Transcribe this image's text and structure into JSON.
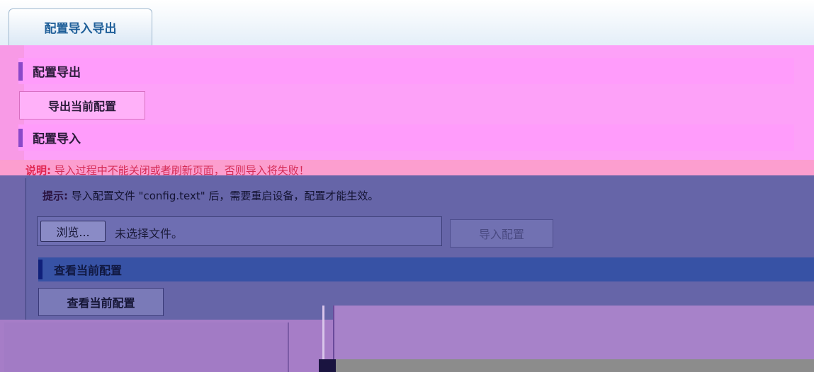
{
  "tab": {
    "label": "配置导入导出"
  },
  "export_section": {
    "title": "配置导出",
    "button_label": "导出当前配置"
  },
  "import_section": {
    "title": "配置导入",
    "note_prefix": "说明:",
    "note_text": "导入过程中不能关闭或者刷新页面，否则导入将失败！",
    "tip_prefix": "提示:",
    "tip_text": "导入配置文件 \"config.text\" 后，需要重启设备，配置才能生效。",
    "browse_label": "浏览...",
    "file_status": "未选择文件。",
    "import_button_label": "导入配置"
  },
  "view_section": {
    "title": "查看当前配置",
    "button_label": "查看当前配置"
  },
  "colors": {
    "pink_overlay": "#fda1f8",
    "purple_overlay": "#6665a8",
    "blue_bar": "#3752a5",
    "note_red": "#d52d57"
  }
}
